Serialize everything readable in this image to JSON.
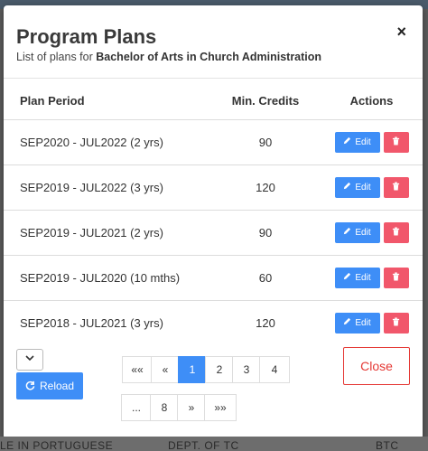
{
  "modal": {
    "title": "Program Plans",
    "subtitle_prefix": "List of plans for ",
    "subtitle_program": "Bachelor of Arts in Church Administration",
    "close_symbol": "×"
  },
  "table": {
    "headers": {
      "period": "Plan Period",
      "credits": "Min. Credits",
      "actions": "Actions"
    },
    "rows": [
      {
        "period": "SEP2020 - JUL2022 (2 yrs)",
        "credits": "90"
      },
      {
        "period": "SEP2019 - JUL2022 (3 yrs)",
        "credits": "120"
      },
      {
        "period": "SEP2019 - JUL2021 (2 yrs)",
        "credits": "90"
      },
      {
        "period": "SEP2019 - JUL2020 (10 mths)",
        "credits": "60"
      },
      {
        "period": "SEP2018 - JUL2021 (3 yrs)",
        "credits": "120"
      }
    ],
    "edit_label": "Edit",
    "edit_icon": "pencil-icon",
    "delete_icon": "trash-icon"
  },
  "footer": {
    "reload_label": "Reload",
    "reload_icon": "refresh-icon",
    "select_icon": "chevron-down-icon",
    "pagination": {
      "first": "««",
      "prev": "«",
      "pages_row1": [
        "1",
        "2",
        "3",
        "4"
      ],
      "ellipsis": "...",
      "page_last": "8",
      "next": "»",
      "last": "»»",
      "active_page": "1"
    },
    "close_label": "Close"
  },
  "background": {
    "bottom_text_left": "LE IN PORTUGUESE",
    "bottom_text_mid": "DEPT. OF TC",
    "bottom_text_right": "BTC"
  },
  "colors": {
    "primary": "#3e8ef7",
    "danger": "#f1576b",
    "close_border": "#e53935"
  }
}
